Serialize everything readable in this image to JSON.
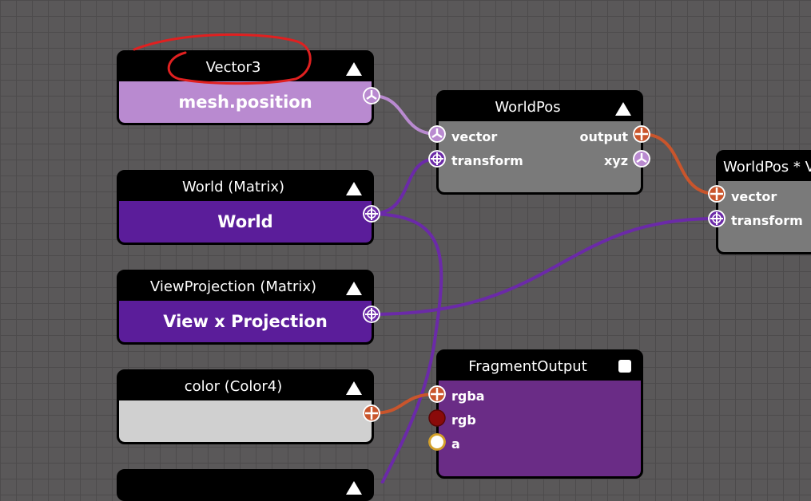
{
  "nodes": {
    "vector3": {
      "title": "Vector3",
      "value": "mesh.position"
    },
    "world": {
      "title": "World (Matrix)",
      "value": "World"
    },
    "viewproj": {
      "title": "ViewProjection (Matrix)",
      "value": "View x Projection"
    },
    "color": {
      "title": "color (Color4)",
      "value": ""
    },
    "worldpos": {
      "title": "WorldPos",
      "inputs": [
        "vector",
        "transform"
      ],
      "outputs": [
        "output",
        "xyz"
      ]
    },
    "worldposv": {
      "title": "WorldPos * V",
      "inputs": [
        "vector",
        "transform"
      ]
    },
    "fragout": {
      "title": "FragmentOutput",
      "inputs": [
        "rgba",
        "rgb",
        "a"
      ]
    }
  },
  "colors": {
    "canvas": "#5a5859",
    "vector3_body": "#b98ad0",
    "matrix_body": "#5b1d9a",
    "color_body": "#d0d0d0",
    "node_gray": "#7a7a7a",
    "fragment_body": "#6a2c86",
    "wire_vector3": "#b98ad0",
    "wire_matrix": "#6b2aa8",
    "wire_color4": "#c9552c",
    "annotation": "#e02020"
  }
}
